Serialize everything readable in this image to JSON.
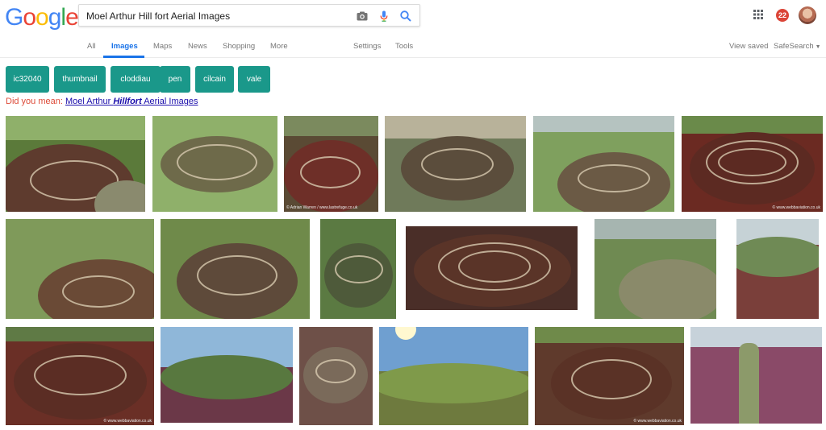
{
  "brand": {
    "name": "Google",
    "letters": [
      {
        "ch": "G",
        "color": "#4285F4"
      },
      {
        "ch": "o",
        "color": "#EA4335"
      },
      {
        "ch": "o",
        "color": "#FBBC05"
      },
      {
        "ch": "g",
        "color": "#4285F4"
      },
      {
        "ch": "l",
        "color": "#34A853"
      },
      {
        "ch": "e",
        "color": "#EA4335"
      }
    ]
  },
  "search": {
    "value": "Moel Arthur Hill fort Aerial Images",
    "icons": [
      "camera-icon",
      "mic-icon",
      "search-icon"
    ]
  },
  "account": {
    "notifications": "22"
  },
  "nav": {
    "tabs": [
      {
        "label": "All",
        "active": false
      },
      {
        "label": "Images",
        "active": true
      },
      {
        "label": "Maps",
        "active": false
      },
      {
        "label": "News",
        "active": false
      },
      {
        "label": "Shopping",
        "active": false
      },
      {
        "label": "More",
        "active": false
      }
    ],
    "settings": "Settings",
    "tools": "Tools",
    "view_saved": "View saved",
    "safesearch": "SafeSearch"
  },
  "chips": [
    "ic32040",
    "thumbnail",
    "cloddiau",
    "pen",
    "cilcain",
    "vale"
  ],
  "did_you_mean": {
    "prefix": "Did you mean:",
    "link_pre": "Moel Arthur ",
    "link_bold": "Hillfort",
    "link_post": " Aerial Images"
  },
  "images": {
    "captions": [
      "© Adrian Warren / www.lastrefuge.co.uk",
      "© www.webbaviation.co.uk"
    ]
  },
  "colors": {
    "accent_blue": "#1a73e8",
    "chip_green": "#1a988a",
    "dym_red": "#dd4b39",
    "link_blue": "#1a0dab"
  }
}
